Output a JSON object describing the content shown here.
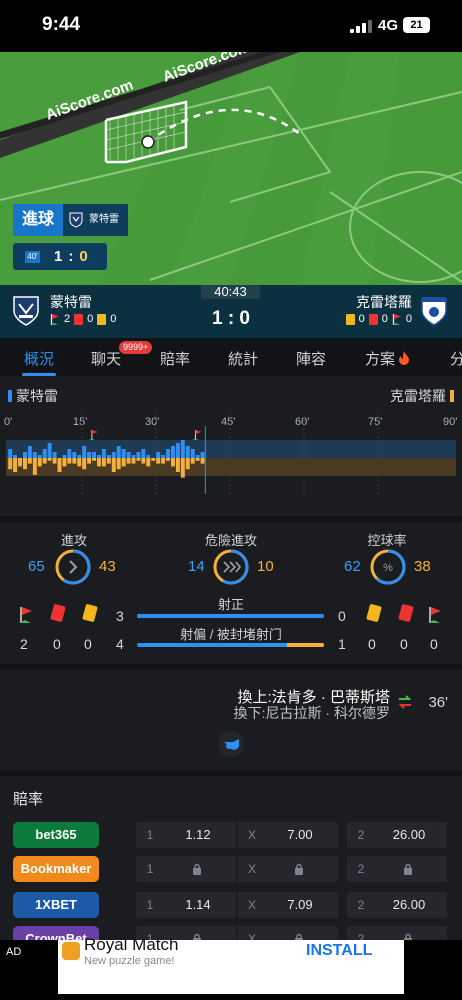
{
  "status": {
    "time": "9:44",
    "network": "4G",
    "battery": "21"
  },
  "pitch": {
    "watermark_1": "AiScore.com",
    "watermark_2": "AiScore.com",
    "event_label": "進球",
    "event_team": "蒙特雷",
    "mini_minute": "40'",
    "mini_home": "1",
    "mini_sep": ":",
    "mini_away": "0"
  },
  "match": {
    "home_team": "蒙特雷",
    "away_team": "克雷塔羅",
    "clock": "40:43",
    "score": "1 : 0",
    "home_counts": {
      "corners": "2",
      "red": "0",
      "yellow": "0"
    },
    "away_counts": {
      "yellow": "0",
      "red": "0",
      "corners": "0"
    }
  },
  "tabs": [
    {
      "label": "概況"
    },
    {
      "label": "聊天"
    },
    {
      "label": "賠率"
    },
    {
      "label": "統計"
    },
    {
      "label": "陣容"
    },
    {
      "label": "方案"
    },
    {
      "label": "分"
    }
  ],
  "chat_badge": "9999+",
  "timeline": {
    "home": "蒙特雷",
    "away": "克雷塔羅",
    "ticks": [
      "0'",
      "15'",
      "30'",
      "45'",
      "60'",
      "75'",
      "90'"
    ]
  },
  "stats": {
    "attacks": {
      "label": "進攻",
      "home": "65",
      "away": "43"
    },
    "dangerous": {
      "label": "危險進攻",
      "home": "14",
      "away": "10"
    },
    "possession": {
      "label": "控球率",
      "home": "62",
      "away": "38"
    },
    "shots_on": {
      "label": "射正",
      "home": "3",
      "away": "0",
      "home_frac": 1.0
    },
    "shots_off": {
      "label": "射偏 / 被封堵射门",
      "home": "4",
      "away": "1",
      "home_frac": 0.8
    },
    "home_cards": {
      "corners": "2",
      "red": "0",
      "yellow": "0"
    },
    "away_cards": {
      "yellow": "0",
      "red": "0",
      "corners": "0"
    }
  },
  "substitution": {
    "on": "換上:法肯多 · 巴蒂斯塔",
    "off": "換下:尼古拉斯 · 科尔德罗",
    "minute": "36'"
  },
  "odds": {
    "title": "賠率",
    "rows": [
      {
        "bookmaker": "bet365",
        "color": "#0b7a3b",
        "text_color": "#ffffff",
        "k1": "1",
        "v1": "1.12",
        "kx": "X",
        "vx": "7.00",
        "k2": "2",
        "v2": "26.00",
        "locked": false
      },
      {
        "bookmaker": "Bookmaker",
        "color": "#f08a1c",
        "text_color": "#ffffff",
        "k1": "1",
        "v1": "",
        "kx": "X",
        "vx": "",
        "k2": "2",
        "v2": "",
        "locked": true
      },
      {
        "bookmaker": "1XBET",
        "color": "#1c5aa8",
        "text_color": "#ffffff",
        "k1": "1",
        "v1": "1.14",
        "kx": "X",
        "vx": "7.09",
        "k2": "2",
        "v2": "26.00",
        "locked": false
      },
      {
        "bookmaker": "CrownBet",
        "color": "#6b3fa8",
        "text_color": "#ffffff",
        "k1": "1",
        "v1": "",
        "kx": "X",
        "vx": "",
        "k2": "2",
        "v2": "",
        "locked": true
      }
    ]
  },
  "ad": {
    "tag": "AD",
    "title": "Royal Match",
    "subtitle": "New puzzle game!",
    "button": "INSTALL"
  },
  "chart_data": {
    "type": "bar",
    "title": "",
    "x_ticks": [
      "0'",
      "15'",
      "30'",
      "45'",
      "60'",
      "75'",
      "90'"
    ],
    "current_minute": 40,
    "home_pressure": [
      3,
      1,
      0,
      2,
      4,
      2,
      1,
      3,
      5,
      2,
      0,
      1,
      3,
      2,
      1,
      4,
      2,
      2,
      1,
      3,
      1,
      2,
      4,
      3,
      2,
      1,
      2,
      3,
      1,
      0,
      2,
      1,
      3,
      4,
      5,
      6,
      4,
      3,
      1,
      2
    ],
    "away_pressure": [
      4,
      5,
      3,
      4,
      2,
      6,
      3,
      2,
      1,
      2,
      5,
      3,
      2,
      2,
      3,
      4,
      2,
      1,
      3,
      3,
      2,
      5,
      4,
      3,
      2,
      2,
      1,
      2,
      3,
      1,
      2,
      2,
      1,
      3,
      5,
      7,
      4,
      2,
      1,
      2
    ],
    "home_goal_minute": 36,
    "home_corner_minutes": [
      17,
      38
    ],
    "sub_minute": 36
  }
}
